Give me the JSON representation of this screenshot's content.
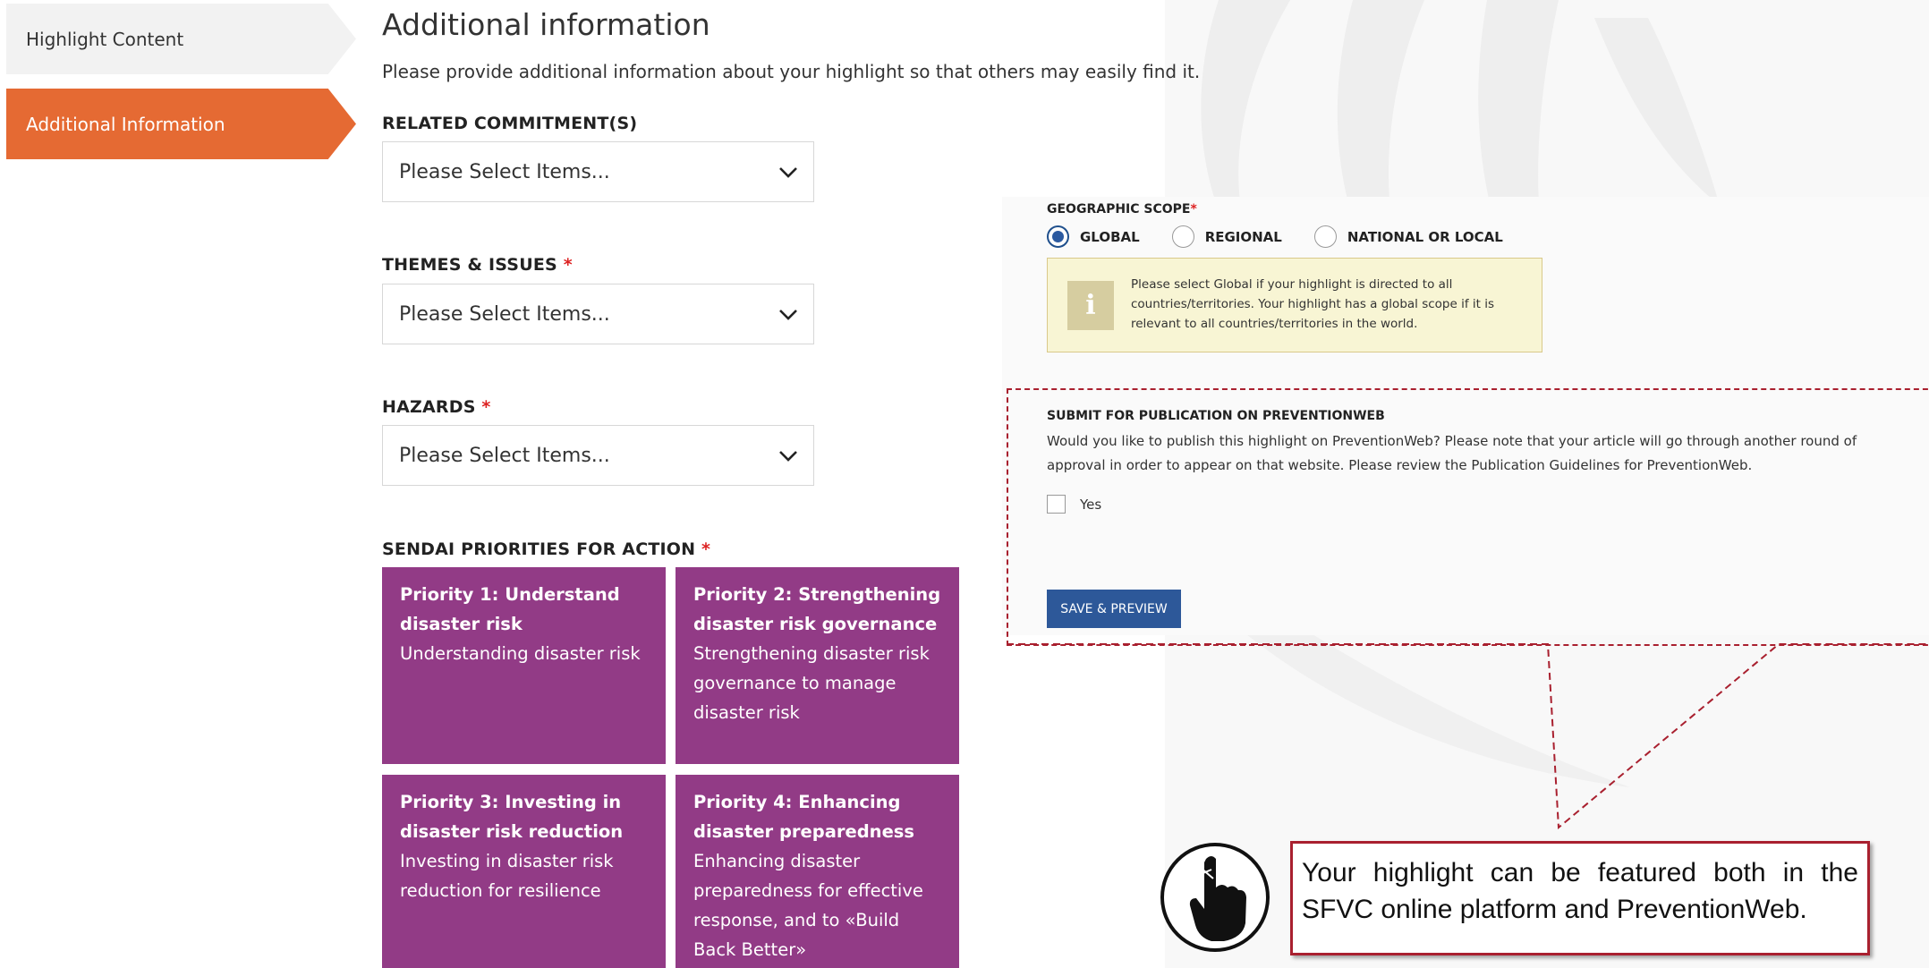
{
  "steps": {
    "content": "Highlight Content",
    "additional": "Additional Information"
  },
  "page": {
    "title": "Additional information",
    "intro": "Please provide additional information about your highlight so that others may easily find it."
  },
  "fields": {
    "commitments": {
      "label": "RELATED COMMITMENT(S)",
      "placeholder": "Please Select Items..."
    },
    "themes": {
      "label": "THEMES & ISSUES",
      "required": "*",
      "placeholder": "Please Select Items..."
    },
    "hazards": {
      "label": "HAZARDS",
      "required": "*",
      "placeholder": "Please Select Items..."
    }
  },
  "sendai": {
    "label": "SENDAI PRIORITIES FOR ACTION",
    "required": "*",
    "priorities": [
      {
        "title": "Priority 1: Understand disaster risk",
        "desc": "Understanding disaster risk"
      },
      {
        "title": "Priority 2: Strengthening disaster risk governance",
        "desc": "Strengthening disaster risk governance to manage disaster risk"
      },
      {
        "title": "Priority 3: Investing in disaster risk reduction",
        "desc": "Investing in disaster risk reduction for resilience"
      },
      {
        "title": "Priority 4: Enhancing disaster preparedness",
        "desc": "Enhancing disaster preparedness for effective response, and to «Build Back Better»"
      }
    ],
    "color": "#923b86"
  },
  "geo": {
    "label": "GEOGRAPHIC SCOPE",
    "required": "*",
    "options": [
      "GLOBAL",
      "REGIONAL",
      "NATIONAL OR LOCAL"
    ],
    "selected": "GLOBAL",
    "info_icon": "i",
    "info": "Please select Global if your highlight is directed to all countries/territories. Your highlight has a global scope if it is relevant to all countries/territories in the world."
  },
  "publication": {
    "title": "SUBMIT FOR PUBLICATION ON PREVENTIONWEB",
    "text": "Would you like to publish this highlight on PreventionWeb? Please note that your article will go through another round of approval in order to appear on that website. Please review the Publication Guidelines for PreventionWeb.",
    "checkbox_label": "Yes",
    "checked": false
  },
  "save_button": "SAVE & PREVIEW",
  "callout": {
    "icon": "pointing-hand-icon",
    "text": "Your highlight can be featured both in the SFVC online platform and PreventionWeb."
  },
  "colors": {
    "accent": "#e56a33",
    "primary": "#2d5899",
    "callout": "#a9202f"
  }
}
